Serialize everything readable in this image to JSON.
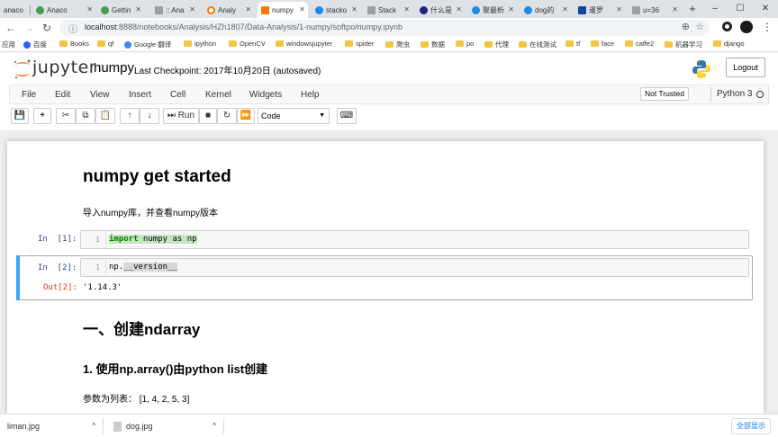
{
  "browser": {
    "tabs": [
      {
        "label": "anaco",
        "color": "#e8e8e8"
      },
      {
        "label": "Anaco",
        "color": "#43a047"
      },
      {
        "label": "Gettin",
        "color": "#43a047"
      },
      {
        "label": ":: Ana",
        "color": "#9e9e9e"
      },
      {
        "label": "Analy",
        "color": "#f57c00"
      },
      {
        "label": "numpy",
        "color": "#f57c00",
        "active": true
      },
      {
        "label": "stacko",
        "color": "#1e88e5"
      },
      {
        "label": "Stack",
        "color": "#9e9e9e"
      },
      {
        "label": "什么是",
        "color": "#1a237e"
      },
      {
        "label": "聚最析",
        "color": "#1e88e5"
      },
      {
        "label": "dog的",
        "color": "#1e88e5"
      },
      {
        "label": "暹罗",
        "color": "#0d47a1"
      },
      {
        "label": "u=36",
        "color": "#9e9e9e"
      }
    ],
    "url_host": "localhost",
    "url_rest": ":8888/notebooks/Analysis/HZh1807/Data-Analysis/1-numpy/softpo/numpy.ipynb",
    "bookmarks": [
      {
        "label": "应用",
        "type": "apps"
      },
      {
        "label": "百度",
        "type": "icon",
        "color": "#2962ff"
      },
      {
        "label": "Books",
        "type": "folder"
      },
      {
        "label": "qf",
        "type": "folder"
      },
      {
        "label": "Google 翻译",
        "type": "icon",
        "color": "#4285f4"
      },
      {
        "label": "ipython",
        "type": "folder"
      },
      {
        "label": "OpenCV",
        "type": "folder"
      },
      {
        "label": "windowsjupyter",
        "type": "folder"
      },
      {
        "label": "spider",
        "type": "folder"
      },
      {
        "label": "爬虫",
        "type": "folder"
      },
      {
        "label": "数据",
        "type": "folder"
      },
      {
        "label": "po",
        "type": "folder"
      },
      {
        "label": "代理",
        "type": "folder"
      },
      {
        "label": "在线测试",
        "type": "folder"
      },
      {
        "label": "tf",
        "type": "folder"
      },
      {
        "label": "face",
        "type": "folder"
      },
      {
        "label": "caffe2",
        "type": "folder"
      },
      {
        "label": "机器学习",
        "type": "folder"
      },
      {
        "label": "django",
        "type": "folder"
      }
    ]
  },
  "jupyter": {
    "logo": "jupyter",
    "notebook_name": "numpy",
    "checkpoint": "Last Checkpoint: 2017年10月20日   (autosaved)",
    "logout": "Logout",
    "menus": [
      "File",
      "Edit",
      "View",
      "Insert",
      "Cell",
      "Kernel",
      "Widgets",
      "Help"
    ],
    "not_trusted": "Not Trusted",
    "kernel": "Python 3",
    "run_label": "Run",
    "cell_type": "Code"
  },
  "cells": {
    "h1": "numpy get started",
    "p1": "导入numpy库，并查看numpy版本",
    "c1_prompt": "In  [1]:",
    "c1_lineno": "1",
    "c1_kw": "import",
    "c1_rest": " numpy as np",
    "c2_prompt": "In  [2]:",
    "c2_lineno": "1",
    "c2_pre": "np.",
    "c2_attr": "__version__",
    "out2_prompt": "Out[2]:",
    "out2_value": "'1.14.3'",
    "h2a": "一、创建ndarray",
    "h2b": "1. 使用np.array()由python list创建",
    "p2": "参数为列表： [1, 4, 2, 5, 3]"
  },
  "downloads": {
    "items": [
      "liman.jpg",
      "dog.jpg"
    ],
    "show_all": "全部显示"
  },
  "colors": {
    "prompt_in": "#303f9f",
    "prompt_out": "#d84315",
    "selected_bar": "#42a5f5",
    "keyword": "#008000"
  }
}
